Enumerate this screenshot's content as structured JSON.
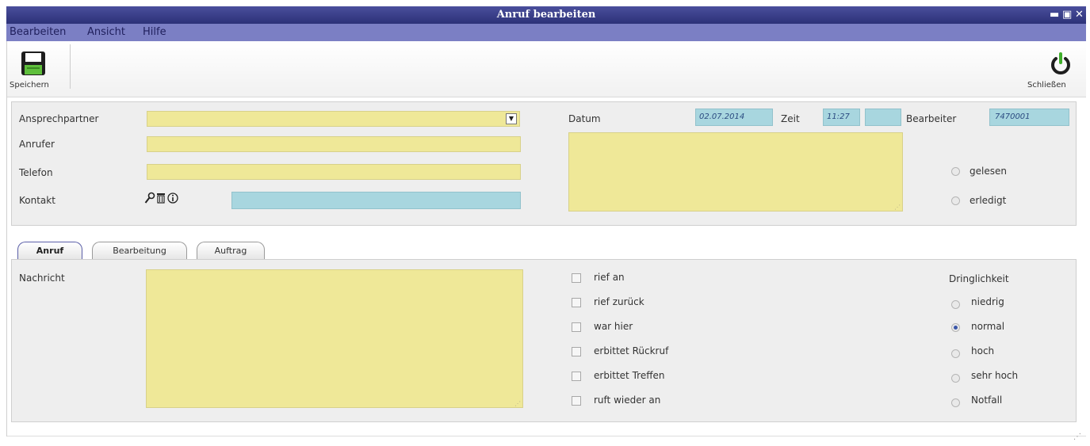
{
  "window": {
    "title": "Anruf bearbeiten",
    "minimize": "▬",
    "maximize": "▣",
    "close": "✕"
  },
  "menu": {
    "items": [
      {
        "label": "Bearbeiten"
      },
      {
        "label": "Ansicht"
      },
      {
        "label": "Hilfe"
      }
    ]
  },
  "toolbar": {
    "save_label": "Speichern",
    "save_icon": "floppy-disk-icon",
    "close_label": "Schließen",
    "close_icon": "power-icon"
  },
  "header": {
    "ansprechpartner_label": "Ansprechpartner",
    "ansprechpartner_value": "",
    "anrufer_label": "Anrufer",
    "anrufer_value": "",
    "telefon_label": "Telefon",
    "telefon_value": "",
    "kontakt_label": "Kontakt",
    "kontakt_value": "",
    "datum_label": "Datum",
    "datum_value": "02.07.2014",
    "zeit_label": "Zeit",
    "zeit_value": "11:27",
    "zeit_extra_value": "",
    "bearbeiter_label": "Bearbeiter",
    "bearbeiter_value": "7470001",
    "gelesen_label": "gelesen",
    "erledigt_label": "erledigt"
  },
  "tabs": [
    {
      "label": "Anruf",
      "active": true
    },
    {
      "label": "Bearbeitung",
      "active": false
    },
    {
      "label": "Auftrag",
      "active": false
    }
  ],
  "anruf_tab": {
    "nachricht_label": "Nachricht",
    "nachricht_value": "",
    "checkboxes": [
      {
        "label": "rief an",
        "checked": false
      },
      {
        "label": "rief zurück",
        "checked": false
      },
      {
        "label": "war hier",
        "checked": false
      },
      {
        "label": "erbittet Rückruf",
        "checked": false
      },
      {
        "label": "erbittet Treffen",
        "checked": false
      },
      {
        "label": "ruft wieder an",
        "checked": false
      }
    ],
    "dringlichkeit_label": "Dringlichkeit",
    "dringlichkeit_options": [
      {
        "label": "niedrig",
        "selected": false
      },
      {
        "label": "normal",
        "selected": true
      },
      {
        "label": "hoch",
        "selected": false
      },
      {
        "label": "sehr hoch",
        "selected": false
      },
      {
        "label": "Notfall",
        "selected": false
      }
    ]
  },
  "colors": {
    "titlebar": "#2c3178",
    "menubar": "#7b7fc4",
    "field_yellow": "#efe898",
    "field_blue": "#a8d6df"
  }
}
